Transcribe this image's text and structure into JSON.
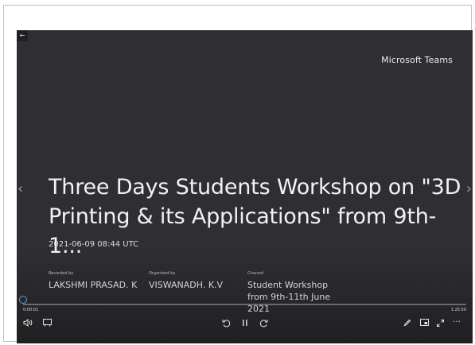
{
  "header": {
    "back_label": "←",
    "brand": "Microsoft Teams"
  },
  "navigation": {
    "prev_label": "‹",
    "next_label": "›"
  },
  "video": {
    "title": "Three Days Students Workshop on \"3D Printing & its Applications\" from 9th-1...",
    "timestamp": "2021-06-09 08:44 UTC"
  },
  "metadata": {
    "recorded_by_label": "Recorded by",
    "recorded_by_value": "LAKSHMI PRASAD. K",
    "organized_by_label": "Organized by",
    "organized_by_value": "VISWANADH. K.V",
    "channel_label": "Channel",
    "channel_value": "Student Workshop from 9th-11th June 2021"
  },
  "playback": {
    "current_time": "0:00:01",
    "total_time": "1:25:50",
    "progress": 0.0002
  },
  "controls": {
    "more_label": "···"
  },
  "icons": {
    "back": "back-arrow-icon",
    "prev": "chevron-left-icon",
    "next": "chevron-right-icon",
    "volume": "volume-icon",
    "captions": "captions-icon",
    "rewind": "rewind-icon",
    "pause": "pause-icon",
    "forward": "fast-forward-icon",
    "edit": "pen-icon",
    "settings": "settings-icon",
    "fullscreen": "fullscreen-icon",
    "more": "more-options-icon"
  },
  "colors": {
    "player_background": "#2f2f33",
    "accent": "#5aa0e6",
    "text": "#f2f2f2"
  }
}
